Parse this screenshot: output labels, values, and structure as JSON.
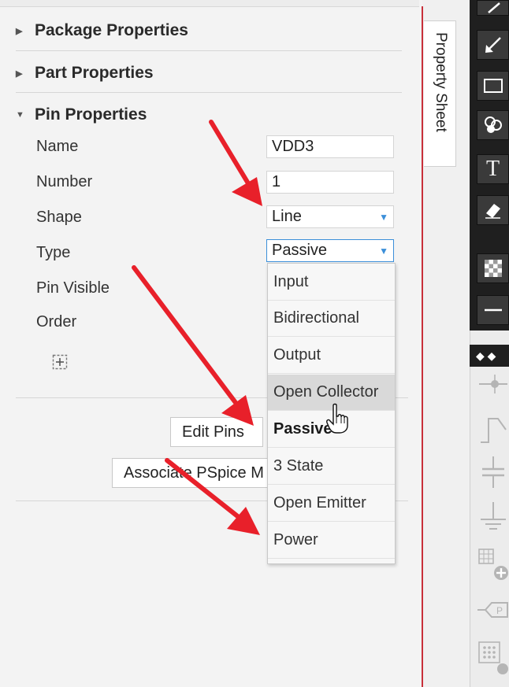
{
  "property_panel": {
    "sections": [
      {
        "label": "Package Properties",
        "expanded": false
      },
      {
        "label": "Part Properties",
        "expanded": false
      },
      {
        "label": "Pin Properties",
        "expanded": true
      }
    ],
    "pin_properties": {
      "name_label": "Name",
      "name_value": "VDD3",
      "number_label": "Number",
      "number_value": "1",
      "shape_label": "Shape",
      "shape_value": "Line",
      "type_label": "Type",
      "type_value": "Passive",
      "pin_visible_label": "Pin Visible",
      "order_label": "Order",
      "add_icon": "plus-box-icon"
    },
    "buttons": {
      "edit_pins": "Edit Pins",
      "associate_pspice": "Associate PSpice M"
    },
    "side_tab": "Property Sheet"
  },
  "type_dropdown": {
    "options": [
      "Input",
      "Bidirectional",
      "Output",
      "Open Collector",
      "Passive",
      "3 State",
      "Open Emitter",
      "Power"
    ],
    "hovered": "Open Collector",
    "selected": "Passive"
  },
  "toolbar": {
    "icons": [
      "line-draw-icon",
      "pin-arrow-icon",
      "rectangle-icon",
      "pin-array-icon",
      "text-icon",
      "eraser-icon",
      "fill-pattern-icon",
      "line-style-icon"
    ],
    "text_tool_label": "T"
  },
  "palette": {
    "icons": [
      "pin-icon",
      "clock-pin-icon",
      "capacitor-icon",
      "ground-icon",
      "add-part-icon",
      "tag-icon",
      "grid-icon"
    ],
    "tag_label": "P"
  },
  "colors": {
    "annotation_arrow": "#e8202a",
    "accent": "#3b8fd9"
  }
}
